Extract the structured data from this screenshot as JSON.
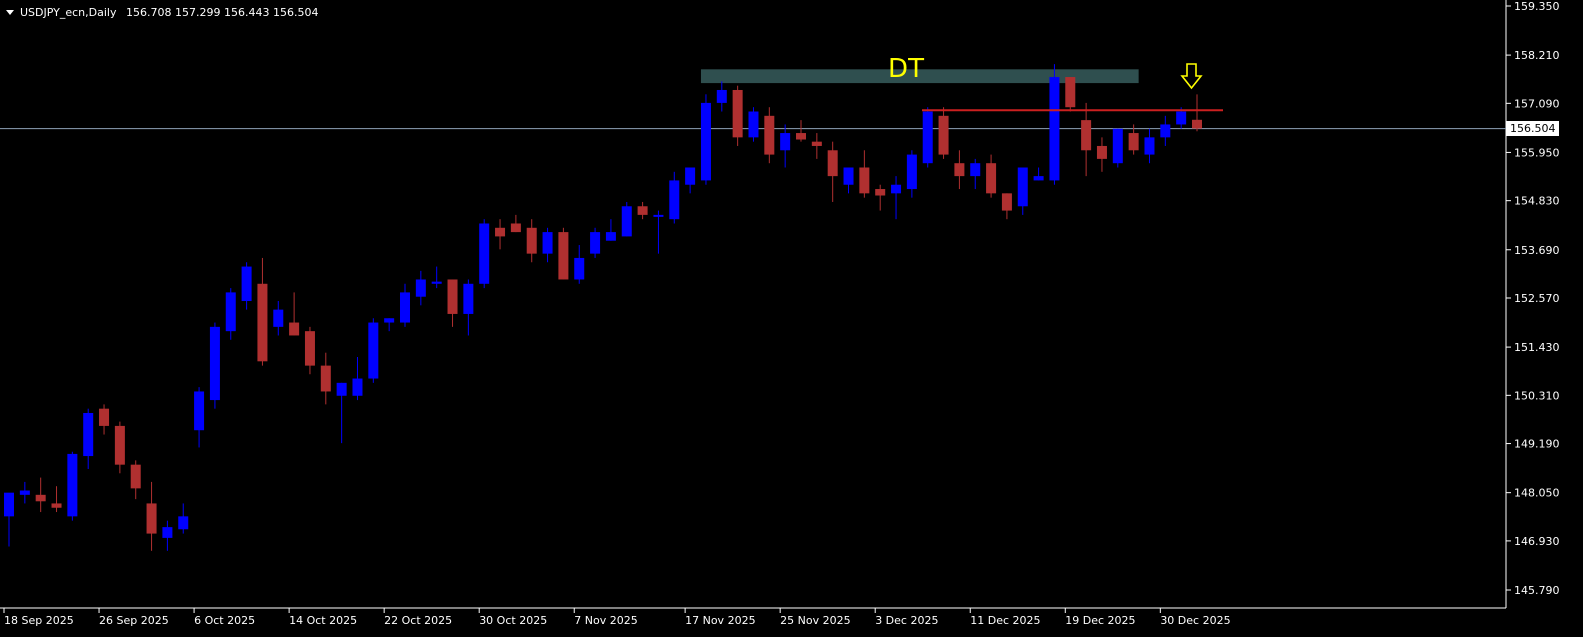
{
  "header": {
    "symbol": "USDJPY_ecn,Daily",
    "ohlc": "156.708 157.299 156.443 156.504"
  },
  "current_price_label": "156.504",
  "annotation": {
    "label": "DT",
    "arrow": "down-arrow-icon"
  },
  "colors": {
    "background": "#000000",
    "bull": "#0000ff",
    "bear": "#b03030",
    "grid_axis": "#ffffff",
    "price_line": "#8fa3b8",
    "zone": "#2f4f4f",
    "resistance_line": "#cc2020",
    "annotation": "#ffff00"
  },
  "chart_data": {
    "type": "candlestick",
    "title": "",
    "xlabel": "",
    "ylabel": "",
    "y_ticks": [
      "159.350",
      "158.210",
      "157.090",
      "155.950",
      "154.830",
      "153.690",
      "152.570",
      "151.430",
      "150.310",
      "149.190",
      "148.050",
      "146.930",
      "145.790"
    ],
    "x_ticks": [
      "18 Sep 2025",
      "26 Sep 2025",
      "6 Oct 2025",
      "14 Oct 2025",
      "22 Oct 2025",
      "30 Oct 2025",
      "7 Nov 2025",
      "17 Nov 2025",
      "25 Nov 2025",
      "3 Dec 2025",
      "11 Dec 2025",
      "19 Dec 2025",
      "30 Dec 2025"
    ],
    "ylim": [
      145.6,
      159.4
    ],
    "current_price": 156.504,
    "resistance_level": 156.93,
    "dt_zone": {
      "from": 157.56,
      "to": 157.88,
      "start_bar": 44,
      "end_bar": 71
    },
    "candles": [
      [
        147.5,
        148.0,
        146.8,
        148.05
      ],
      [
        148.0,
        148.3,
        147.8,
        148.1
      ],
      [
        148.0,
        148.4,
        147.6,
        147.85
      ],
      [
        147.8,
        148.2,
        147.6,
        147.7
      ],
      [
        147.5,
        149.0,
        147.4,
        148.95
      ],
      [
        148.9,
        150.0,
        148.6,
        149.9
      ],
      [
        150.0,
        150.1,
        149.4,
        149.6
      ],
      [
        149.6,
        149.7,
        148.5,
        148.7
      ],
      [
        148.7,
        148.8,
        147.9,
        148.15
      ],
      [
        147.8,
        148.3,
        146.7,
        147.1
      ],
      [
        147.0,
        147.4,
        146.7,
        147.25
      ],
      [
        147.2,
        147.8,
        147.1,
        147.5
      ],
      [
        149.5,
        150.5,
        149.1,
        150.4
      ],
      [
        150.2,
        152.0,
        150.0,
        151.9
      ],
      [
        151.8,
        152.8,
        151.6,
        152.7
      ],
      [
        152.5,
        153.4,
        152.3,
        153.3
      ],
      [
        152.9,
        153.5,
        151.0,
        151.1
      ],
      [
        151.9,
        152.5,
        151.7,
        152.3
      ],
      [
        152.0,
        152.7,
        151.7,
        151.7
      ],
      [
        151.8,
        151.9,
        150.8,
        151.0
      ],
      [
        151.0,
        151.3,
        150.1,
        150.4
      ],
      [
        150.3,
        150.6,
        149.2,
        150.6
      ],
      [
        150.3,
        151.2,
        150.2,
        150.7
      ],
      [
        150.7,
        152.1,
        150.6,
        152.0
      ],
      [
        152.0,
        152.1,
        151.8,
        152.1
      ],
      [
        152.0,
        152.9,
        151.9,
        152.7
      ],
      [
        152.6,
        153.2,
        152.4,
        153.0
      ],
      [
        152.9,
        153.3,
        152.8,
        152.95
      ],
      [
        153.0,
        153.0,
        151.9,
        152.2
      ],
      [
        152.2,
        153.0,
        151.7,
        152.9
      ],
      [
        152.9,
        154.4,
        152.8,
        154.3
      ],
      [
        154.2,
        154.4,
        153.7,
        154.0
      ],
      [
        154.3,
        154.5,
        154.1,
        154.1
      ],
      [
        154.2,
        154.4,
        153.4,
        153.6
      ],
      [
        153.6,
        154.2,
        153.4,
        154.1
      ],
      [
        154.1,
        154.2,
        153.0,
        153.0
      ],
      [
        153.0,
        153.8,
        152.9,
        153.5
      ],
      [
        153.6,
        154.2,
        153.5,
        154.1
      ],
      [
        153.9,
        154.4,
        153.9,
        154.1
      ],
      [
        154.0,
        154.8,
        154.0,
        154.7
      ],
      [
        154.7,
        154.8,
        154.4,
        154.5
      ],
      [
        154.5,
        154.6,
        153.6,
        154.5
      ],
      [
        154.4,
        155.5,
        154.3,
        155.3
      ],
      [
        155.2,
        155.5,
        155.0,
        155.6
      ],
      [
        155.3,
        157.3,
        155.2,
        157.1
      ],
      [
        157.1,
        157.6,
        156.9,
        157.4
      ],
      [
        157.4,
        157.5,
        156.1,
        156.3
      ],
      [
        156.3,
        157.0,
        156.2,
        156.9
      ],
      [
        156.8,
        157.0,
        155.7,
        155.9
      ],
      [
        156.0,
        156.6,
        155.6,
        156.4
      ],
      [
        156.4,
        156.7,
        156.2,
        156.25
      ],
      [
        156.2,
        156.4,
        155.8,
        156.1
      ],
      [
        156.0,
        156.2,
        154.8,
        155.4
      ],
      [
        155.2,
        155.6,
        155.0,
        155.6
      ],
      [
        155.6,
        156.0,
        154.9,
        155.0
      ],
      [
        155.1,
        155.2,
        154.6,
        154.95
      ],
      [
        155.0,
        155.4,
        154.4,
        155.2
      ],
      [
        155.1,
        156.0,
        154.9,
        155.9
      ],
      [
        155.7,
        157.0,
        155.6,
        156.9
      ],
      [
        156.8,
        157.0,
        155.8,
        155.9
      ],
      [
        155.7,
        156.0,
        155.1,
        155.4
      ],
      [
        155.4,
        155.8,
        155.1,
        155.7
      ],
      [
        155.7,
        155.9,
        154.9,
        155.0
      ],
      [
        155.0,
        155.0,
        154.4,
        154.6
      ],
      [
        154.7,
        155.6,
        154.5,
        155.6
      ],
      [
        155.3,
        155.6,
        155.3,
        155.4
      ],
      [
        155.3,
        158.0,
        155.2,
        157.7
      ],
      [
        157.7,
        157.7,
        156.9,
        157.0
      ],
      [
        156.7,
        157.1,
        155.4,
        156.0
      ],
      [
        156.1,
        156.3,
        155.5,
        155.8
      ],
      [
        155.7,
        156.5,
        155.6,
        156.5
      ],
      [
        156.4,
        156.6,
        155.9,
        156.0
      ],
      [
        155.9,
        156.5,
        155.7,
        156.3
      ],
      [
        156.3,
        156.8,
        156.1,
        156.6
      ],
      [
        156.6,
        157.0,
        156.5,
        156.9
      ],
      [
        156.708,
        157.299,
        156.443,
        156.504
      ]
    ]
  }
}
